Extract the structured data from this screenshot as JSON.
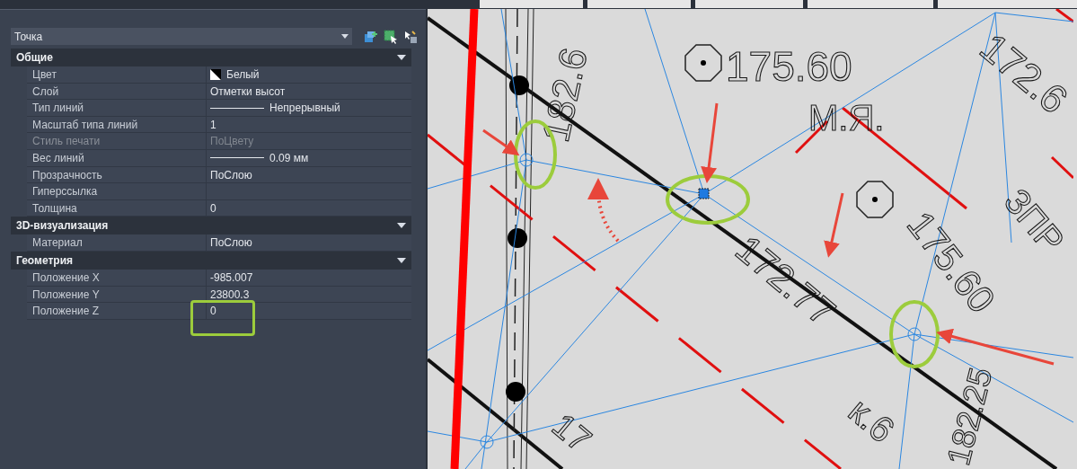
{
  "selector": {
    "value": "Точка"
  },
  "sections": [
    {
      "title": "Общие",
      "expanded": true,
      "rows": [
        {
          "label": "Цвет",
          "value": "Белый",
          "kind": "color",
          "disabled": false
        },
        {
          "label": "Слой",
          "value": "Отметки высот",
          "kind": "text",
          "disabled": false
        },
        {
          "label": "Тип линий",
          "value": "Непрерывный",
          "kind": "line",
          "disabled": false
        },
        {
          "label": "Масштаб типа линий",
          "value": "1",
          "kind": "text",
          "disabled": false
        },
        {
          "label": "Стиль печати",
          "value": "ПоЦвету",
          "kind": "text",
          "disabled": true
        },
        {
          "label": "Вес линий",
          "value": "0.09 мм",
          "kind": "line",
          "disabled": false
        },
        {
          "label": "Прозрачность",
          "value": "ПоСлою",
          "kind": "text",
          "disabled": false
        },
        {
          "label": "Гиперссылка",
          "kind": "text",
          "disabled": false
        },
        {
          "label": "Толщина",
          "value": "0",
          "kind": "text",
          "disabled": false
        }
      ]
    },
    {
      "title": "3D-визуализация",
      "expanded": true,
      "rows": [
        {
          "label": "Материал",
          "value": "ПоСлою",
          "kind": "text",
          "disabled": false
        }
      ]
    },
    {
      "title": "Геометрия",
      "expanded": true,
      "rows": [
        {
          "label": "Положение X",
          "value": "-985.007",
          "kind": "text",
          "disabled": false
        },
        {
          "label": "Положение Y",
          "value": "23800.3",
          "kind": "text",
          "disabled": false
        },
        {
          "label": "Положение Z",
          "value": "0",
          "kind": "text",
          "disabled": false
        }
      ]
    }
  ],
  "drawing": {
    "labels": [
      "175.60",
      "М.Я.",
      "182.6",
      "172.6",
      "172.77",
      "3ПР",
      "175.60",
      "182.25",
      "к.6",
      "17"
    ]
  }
}
